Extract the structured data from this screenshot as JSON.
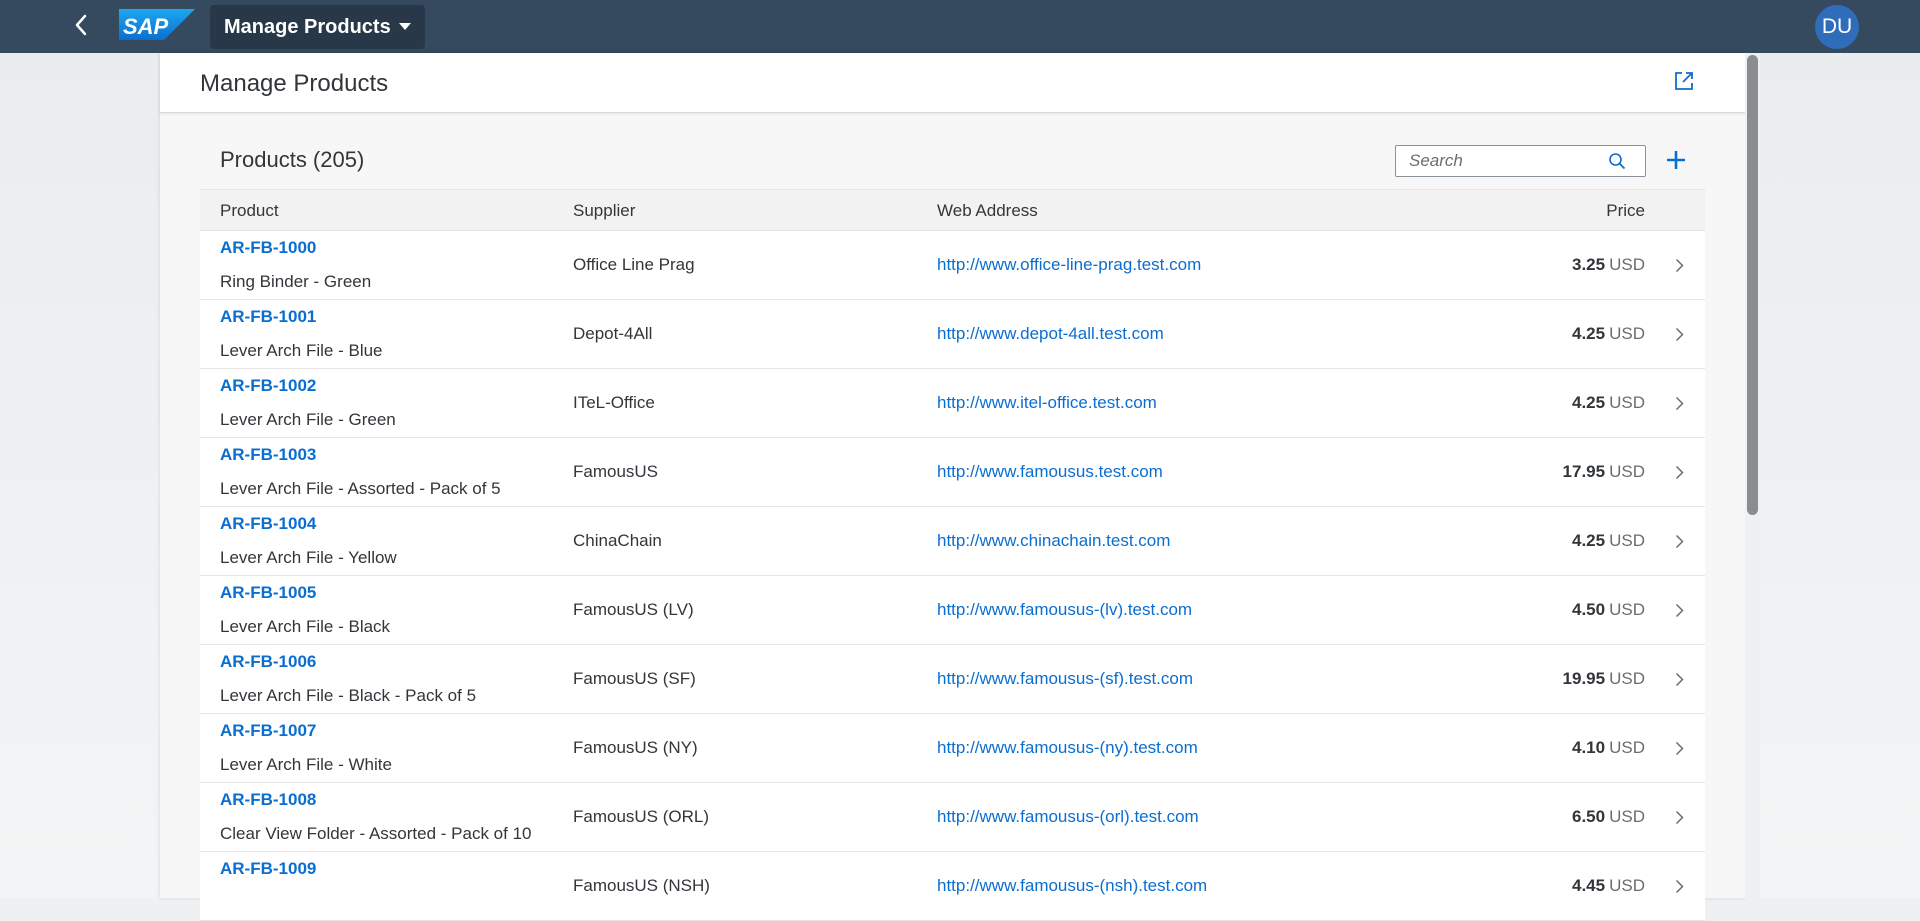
{
  "shell": {
    "app_title": "Manage Products",
    "avatar_initials": "DU",
    "logo_text": "SAP",
    "colors": {
      "bar": "#354a5f",
      "accent": "#0a6ed1",
      "avatar": "#2f6dbb"
    }
  },
  "page": {
    "title": "Manage Products"
  },
  "table": {
    "title": "Products (205)",
    "search_placeholder": "Search",
    "columns": {
      "product": "Product",
      "supplier": "Supplier",
      "web": "Web Address",
      "price": "Price"
    },
    "rows": [
      {
        "id": "AR-FB-1000",
        "name": "Ring Binder - Green",
        "supplier": "Office Line Prag",
        "web": "http://www.office-line-prag.test.com",
        "price": "3.25",
        "currency": "USD"
      },
      {
        "id": "AR-FB-1001",
        "name": "Lever Arch File - Blue",
        "supplier": "Depot-4All",
        "web": "http://www.depot-4all.test.com",
        "price": "4.25",
        "currency": "USD"
      },
      {
        "id": "AR-FB-1002",
        "name": "Lever Arch File - Green",
        "supplier": "ITeL-Office",
        "web": "http://www.itel-office.test.com",
        "price": "4.25",
        "currency": "USD"
      },
      {
        "id": "AR-FB-1003",
        "name": "Lever Arch File - Assorted - Pack of 5",
        "supplier": "FamousUS",
        "web": "http://www.famousus.test.com",
        "price": "17.95",
        "currency": "USD"
      },
      {
        "id": "AR-FB-1004",
        "name": "Lever Arch File - Yellow",
        "supplier": "ChinaChain",
        "web": "http://www.chinachain.test.com",
        "price": "4.25",
        "currency": "USD"
      },
      {
        "id": "AR-FB-1005",
        "name": "Lever Arch File - Black",
        "supplier": "FamousUS (LV)",
        "web": "http://www.famousus-(lv).test.com",
        "price": "4.50",
        "currency": "USD"
      },
      {
        "id": "AR-FB-1006",
        "name": "Lever Arch File - Black - Pack of 5",
        "supplier": "FamousUS (SF)",
        "web": "http://www.famousus-(sf).test.com",
        "price": "19.95",
        "currency": "USD"
      },
      {
        "id": "AR-FB-1007",
        "name": "Lever Arch File - White",
        "supplier": "FamousUS (NY)",
        "web": "http://www.famousus-(ny).test.com",
        "price": "4.10",
        "currency": "USD"
      },
      {
        "id": "AR-FB-1008",
        "name": "Clear View Folder - Assorted - Pack of 10",
        "supplier": "FamousUS (ORL)",
        "web": "http://www.famousus-(orl).test.com",
        "price": "6.50",
        "currency": "USD"
      },
      {
        "id": "AR-FB-1009",
        "name": "",
        "supplier": "FamousUS (NSH)",
        "web": "http://www.famousus-(nsh).test.com",
        "price": "4.45",
        "currency": "USD"
      }
    ]
  }
}
